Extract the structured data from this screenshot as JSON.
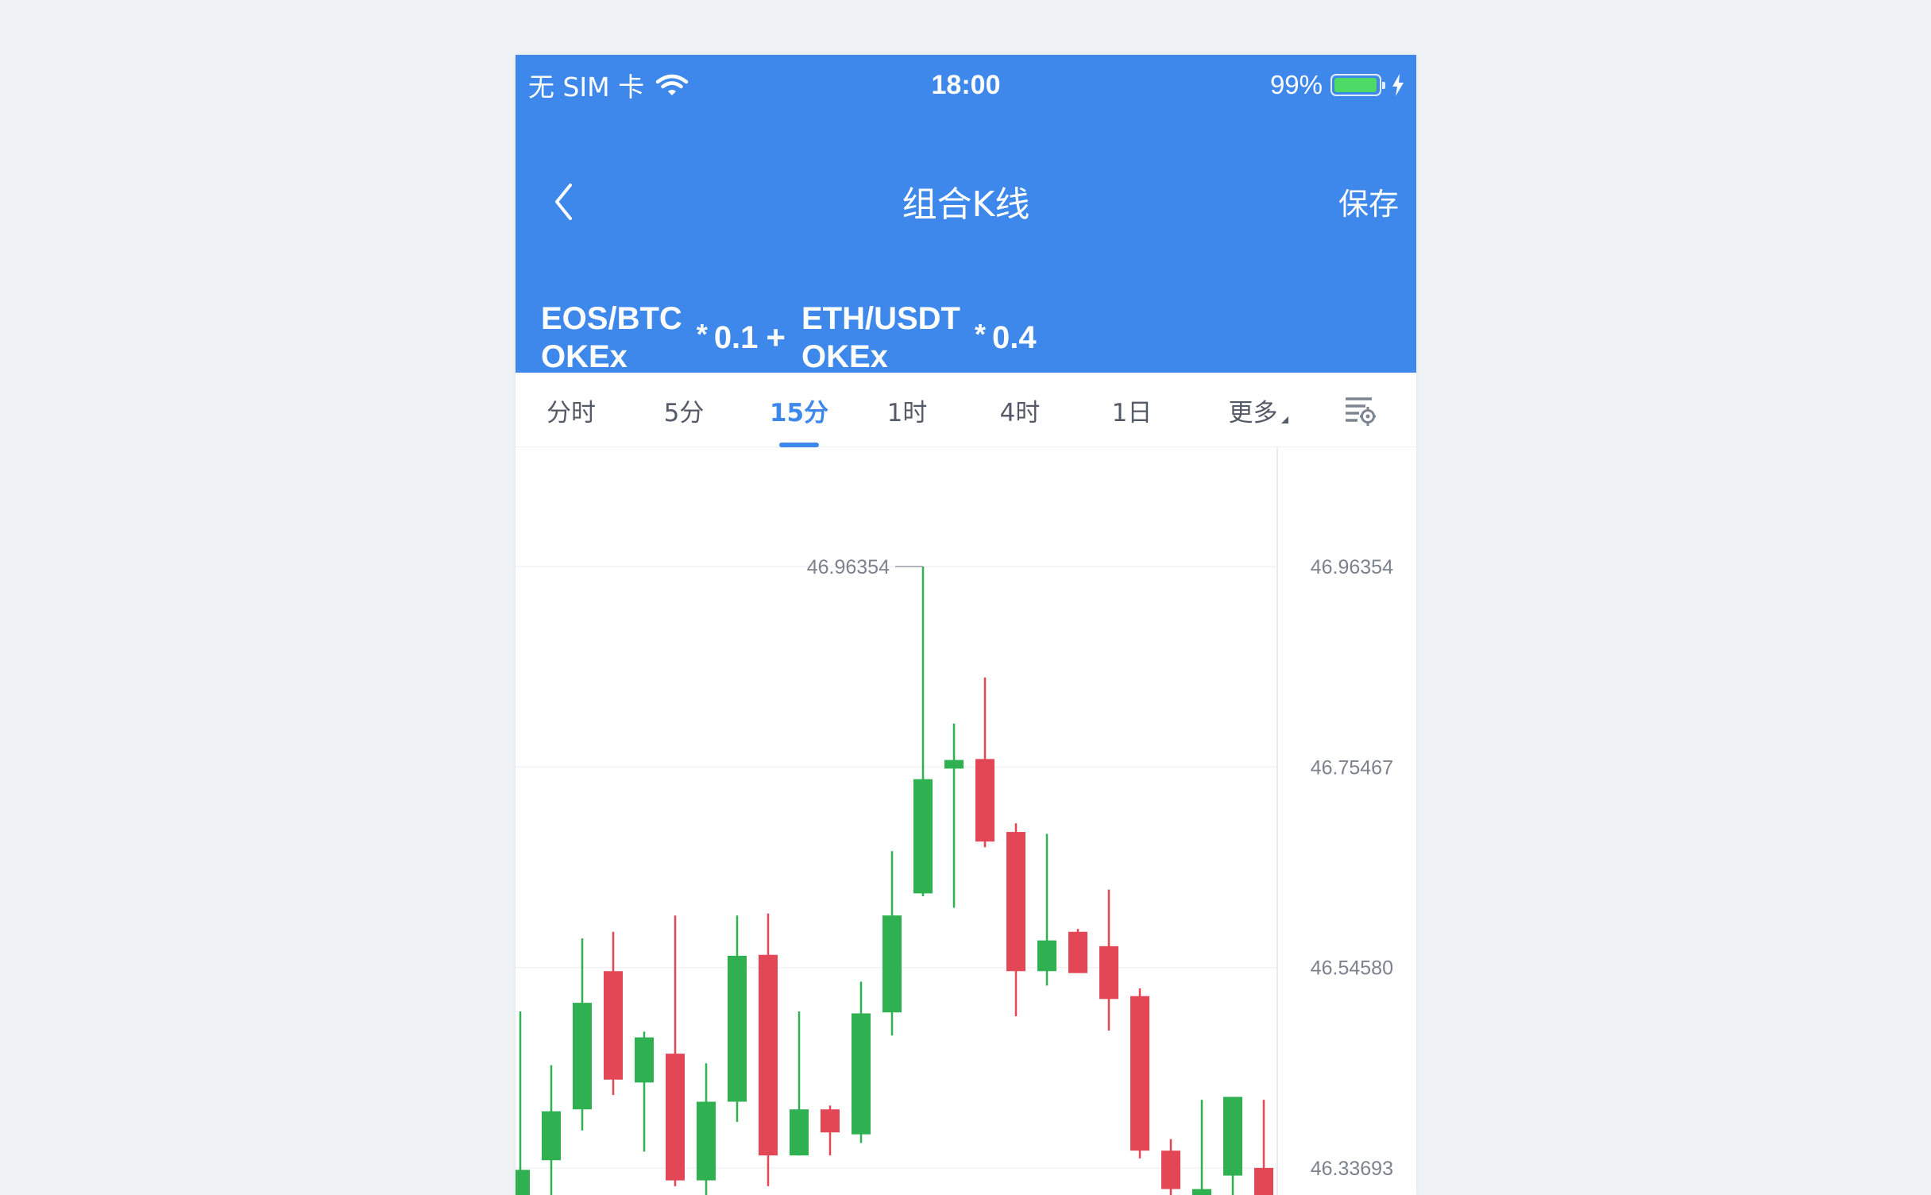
{
  "status_bar": {
    "carrier": "无 SIM 卡",
    "time": "18:00",
    "battery": "99%",
    "battery_level": 0.99
  },
  "nav": {
    "title": "组合K线",
    "save_label": "保存"
  },
  "formula": {
    "pairs": [
      {
        "symbol": "EOS/BTC",
        "exchange": "OKEx",
        "multiplier": "0.1"
      },
      {
        "symbol": "ETH/USDT",
        "exchange": "OKEx",
        "multiplier": "0.4"
      }
    ],
    "operator": "+",
    "multiply_sign": "*"
  },
  "tabs": [
    {
      "label": "分时",
      "active": false
    },
    {
      "label": "5分",
      "active": false
    },
    {
      "label": "15分",
      "active": true
    },
    {
      "label": "1时",
      "active": false
    },
    {
      "label": "4时",
      "active": false
    },
    {
      "label": "1日",
      "active": false
    },
    {
      "label": "更多",
      "active": false,
      "dropdown": true
    }
  ],
  "icons": {
    "back": "chevron-left-icon",
    "wifi": "wifi-icon",
    "charging": "lightning-icon",
    "settings": "chart-settings-icon"
  },
  "colors": {
    "header": "#3e88eb",
    "up": "#2fb151",
    "down": "#e34655",
    "active_tab": "#3e88eb"
  },
  "chart_data": {
    "type": "candlestick",
    "y_axis_labels": [
      "46.96354",
      "46.75467",
      "46.54580",
      "46.33693"
    ],
    "y_ticks": [
      46.96354,
      46.75467,
      46.5458,
      46.33693
    ],
    "max_label": "46.96354",
    "y_range_visible": [
      46.255,
      47.03
    ],
    "candles": [
      {
        "open": 46.284,
        "close": 46.335,
        "high": 46.5,
        "low": 46.255,
        "direction": "up"
      },
      {
        "open": 46.345,
        "close": 46.396,
        "high": 46.444,
        "low": 46.258,
        "direction": "up"
      },
      {
        "open": 46.398,
        "close": 46.509,
        "high": 46.576,
        "low": 46.376,
        "direction": "up"
      },
      {
        "open": 46.542,
        "close": 46.429,
        "high": 46.583,
        "low": 46.413,
        "direction": "down"
      },
      {
        "open": 46.426,
        "close": 46.473,
        "high": 46.479,
        "low": 46.354,
        "direction": "up"
      },
      {
        "open": 46.456,
        "close": 46.324,
        "high": 46.6,
        "low": 46.318,
        "direction": "down"
      },
      {
        "open": 46.324,
        "close": 46.406,
        "high": 46.446,
        "low": 46.294,
        "direction": "up"
      },
      {
        "open": 46.406,
        "close": 46.558,
        "high": 46.6,
        "low": 46.385,
        "direction": "up"
      },
      {
        "open": 46.559,
        "close": 46.35,
        "high": 46.602,
        "low": 46.318,
        "direction": "down"
      },
      {
        "open": 46.35,
        "close": 46.398,
        "high": 46.5,
        "low": 46.35,
        "direction": "up"
      },
      {
        "open": 46.398,
        "close": 46.374,
        "high": 46.402,
        "low": 46.35,
        "direction": "down"
      },
      {
        "open": 46.372,
        "close": 46.498,
        "high": 46.531,
        "low": 46.363,
        "direction": "up"
      },
      {
        "open": 46.499,
        "close": 46.6,
        "high": 46.667,
        "low": 46.475,
        "direction": "up"
      },
      {
        "open": 46.623,
        "close": 46.742,
        "high": 46.96354,
        "low": 46.62,
        "direction": "up"
      },
      {
        "open": 46.753,
        "close": 46.762,
        "high": 46.8,
        "low": 46.608,
        "direction": "up"
      },
      {
        "open": 46.763,
        "close": 46.677,
        "high": 46.848,
        "low": 46.671,
        "direction": "down"
      },
      {
        "open": 46.687,
        "close": 46.542,
        "high": 46.696,
        "low": 46.495,
        "direction": "down"
      },
      {
        "open": 46.542,
        "close": 46.574,
        "high": 46.685,
        "low": 46.527,
        "direction": "up"
      },
      {
        "open": 46.583,
        "close": 46.54,
        "high": 46.586,
        "low": 46.54,
        "direction": "down"
      },
      {
        "open": 46.568,
        "close": 46.513,
        "high": 46.627,
        "low": 46.48,
        "direction": "down"
      },
      {
        "open": 46.516,
        "close": 46.355,
        "high": 46.524,
        "low": 46.347,
        "direction": "down"
      },
      {
        "open": 46.355,
        "close": 46.315,
        "high": 46.367,
        "low": 46.265,
        "direction": "down"
      },
      {
        "open": 46.288,
        "close": 46.315,
        "high": 46.408,
        "low": 46.262,
        "direction": "up"
      },
      {
        "open": 46.329,
        "close": 46.411,
        "high": 46.409,
        "low": 46.285,
        "direction": "up"
      },
      {
        "open": 46.337,
        "close": 46.27,
        "high": 46.408,
        "low": 46.258,
        "direction": "down"
      }
    ],
    "grid": true,
    "legend": "none"
  }
}
